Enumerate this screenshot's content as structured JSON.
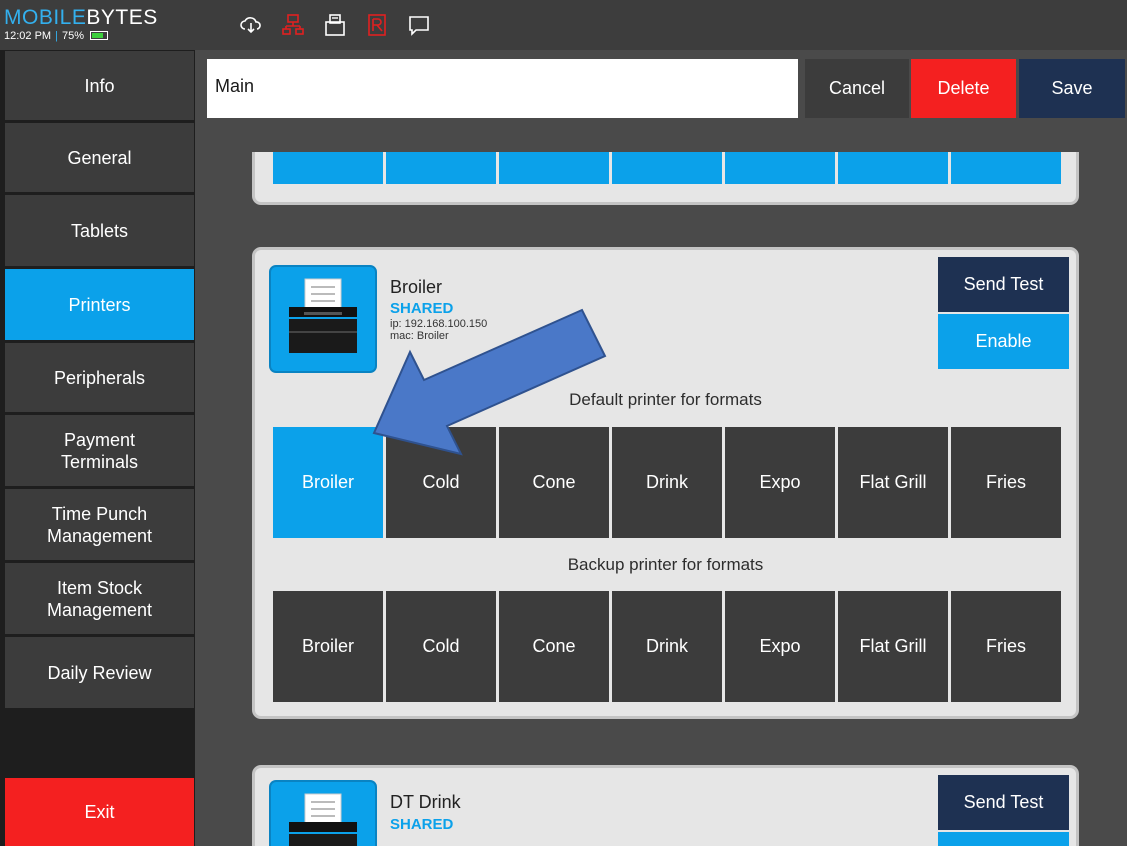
{
  "app": {
    "brand_left": "MOBILE",
    "brand_right": "BYTES",
    "time": "12:02 PM",
    "battery": "75%"
  },
  "topbar_icons": [
    "cloud-sync-icon",
    "network-icon",
    "printer-icon",
    "report-icon",
    "chat-icon"
  ],
  "sidebar": {
    "items": [
      {
        "label": "Info"
      },
      {
        "label": "General"
      },
      {
        "label": "Tablets"
      },
      {
        "label": "Printers",
        "active": true
      },
      {
        "label": "Peripherals"
      },
      {
        "label": "Payment\nTerminals"
      },
      {
        "label": "Time Punch\nManagement"
      },
      {
        "label": "Item Stock\nManagement"
      },
      {
        "label": "Daily Review"
      }
    ],
    "exit_label": "Exit"
  },
  "toolbar": {
    "name_value": "Main",
    "cancel_label": "Cancel",
    "delete_label": "Delete",
    "save_label": "Save"
  },
  "colors": {
    "accent_blue": "#0ba1ea",
    "navy": "#1e3152",
    "danger_red": "#f42020",
    "tile_dark": "#3c3c3c"
  },
  "printers": [
    {
      "name": "Broiler",
      "status": "SHARED",
      "ip": "ip: 192.168.100.150",
      "mac": "mac: Broiler",
      "send_test_label": "Send Test",
      "enable_label": "Enable",
      "default_caption": "Default printer for formats",
      "backup_caption": "Backup printer for formats",
      "formats": [
        "Broiler",
        "Cold",
        "Cone",
        "Drink",
        "Expo",
        "Flat Grill",
        "Fries"
      ],
      "default_selected": [
        "Broiler"
      ],
      "backup_selected": []
    },
    {
      "name": "DT Drink",
      "status": "SHARED",
      "send_test_label": "Send Test"
    }
  ]
}
